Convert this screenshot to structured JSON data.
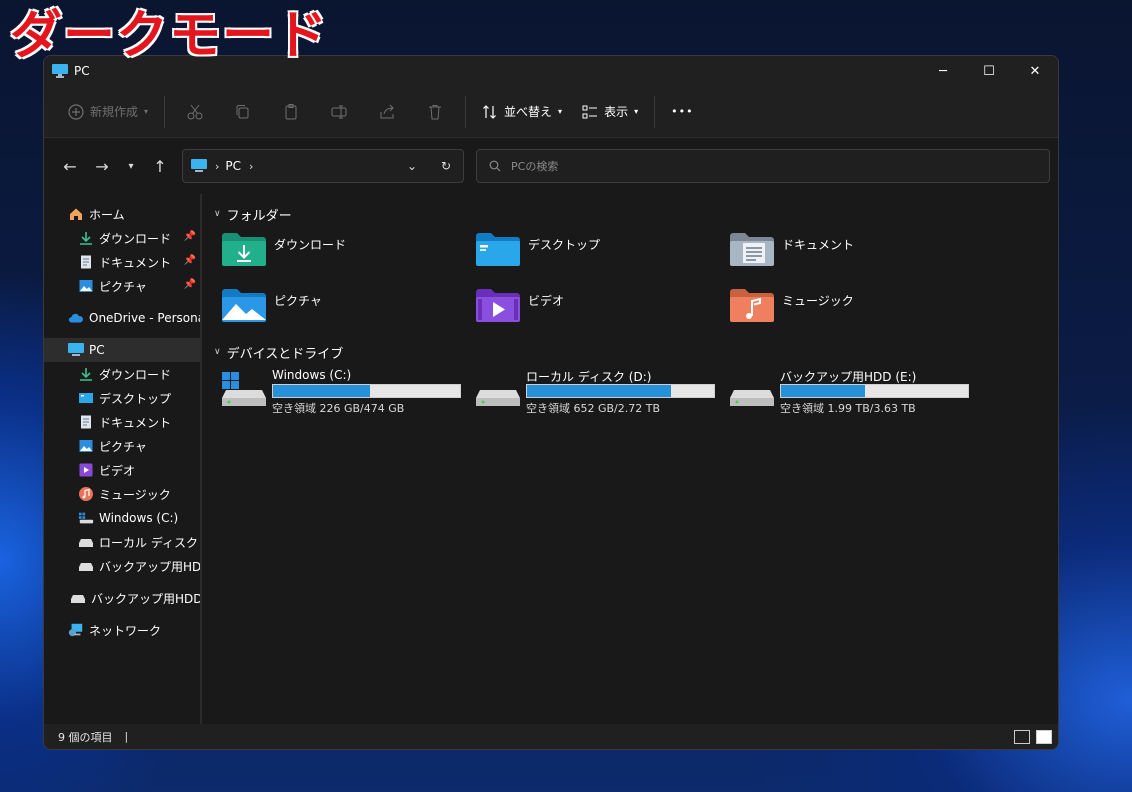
{
  "caption": "ダークモード",
  "window": {
    "title": "PC",
    "controls": {
      "minimize": "─",
      "maximize": "☐",
      "close": "✕"
    }
  },
  "toolbar": {
    "new_label": "新規作成",
    "sort_label": "並べ替え",
    "view_label": "表示",
    "more": "•••"
  },
  "address": {
    "segments": [
      "PC"
    ],
    "search_placeholder": "PCの検索"
  },
  "sidebar": {
    "home": "ホーム",
    "quick": [
      "ダウンロード",
      "ドキュメント",
      "ピクチャ"
    ],
    "onedrive": "OneDrive - Personal",
    "pc": "PC",
    "pc_children": [
      "ダウンロード",
      "デスクトップ",
      "ドキュメント",
      "ピクチャ",
      "ビデオ",
      "ミュージック",
      "Windows (C:)",
      "ローカル ディスク (D:)",
      "バックアップ用HDD (E"
    ],
    "external": "バックアップ用HDD (E:)",
    "network": "ネットワーク"
  },
  "main": {
    "folders_header": "フォルダー",
    "folders": [
      "ダウンロード",
      "デスクトップ",
      "ドキュメント",
      "ピクチャ",
      "ビデオ",
      "ミュージック"
    ],
    "drives_header": "デバイスとドライブ",
    "drives": [
      {
        "name": "Windows (C:)",
        "free": "空き領域 226 GB/474 GB",
        "used_fraction": 0.52
      },
      {
        "name": "ローカル ディスク (D:)",
        "free": "空き領域 652 GB/2.72 TB",
        "used_fraction": 0.77
      },
      {
        "name": "バックアップ用HDD (E:)",
        "free": "空き領域 1.99 TB/3.63 TB",
        "used_fraction": 0.45
      }
    ]
  },
  "status": {
    "count": "9 個の項目",
    "cursor": "|"
  },
  "colors": {
    "accent": "#2690d8",
    "caption_red": "#e4151c",
    "window_bg": "#191919"
  }
}
